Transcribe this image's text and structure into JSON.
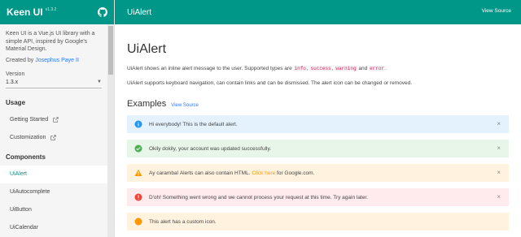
{
  "sidebar": {
    "brand": "Keen UI",
    "version_badge": "v1.3.2",
    "description": "Keen UI is a Vue.js UI library with a simple API, inspired by Google's Material Design.",
    "created_prefix": "Created by ",
    "author": "Josephus Paye II",
    "version_label": "Version",
    "version_value": "1.3.x",
    "usage_heading": "Usage",
    "usage_items": [
      {
        "label": "Getting Started"
      },
      {
        "label": "Customization"
      }
    ],
    "components_heading": "Components",
    "component_items": [
      {
        "label": "UiAlert"
      },
      {
        "label": "UiAutocomplete"
      },
      {
        "label": "UiButton"
      },
      {
        "label": "UiCalendar"
      }
    ]
  },
  "topbar": {
    "title": "UiAlert",
    "view_source": "View Source"
  },
  "main": {
    "title": "UiAlert",
    "para1_prefix": "UiAlert shows an inline alert message to the user. Supported types are ",
    "types": [
      "info",
      "success",
      "warning",
      "error"
    ],
    "para1_sep1": ", ",
    "para1_sep2": ", ",
    "para1_sep3": " and ",
    "para1_suffix": ".",
    "para2": "UiAlert supports keyboard navigation, can contain links and can be dismissed. The alert icon can be changed or removed.",
    "examples_title": "Examples",
    "examples_link": "View Source",
    "alerts": [
      {
        "type": "info",
        "text": "Hi everybody! This is the default alert."
      },
      {
        "type": "success",
        "text": "Okily dokily, your account was updated successfully."
      },
      {
        "type": "warning",
        "text_before": "Ay caramba! Alerts can also contain HTML. ",
        "link": "Click here",
        "text_after": " for Google.com."
      },
      {
        "type": "error",
        "text": "D'oh! Something went wrong and we cannot process your request at this time. Try again later."
      },
      {
        "type": "custom",
        "text": "This alert has a custom icon."
      }
    ],
    "close_glyph": "×"
  },
  "colors": {
    "accent": "#009688",
    "info": "#2196f3",
    "success": "#4caf50",
    "warning": "#ff9800",
    "error": "#f44336"
  }
}
